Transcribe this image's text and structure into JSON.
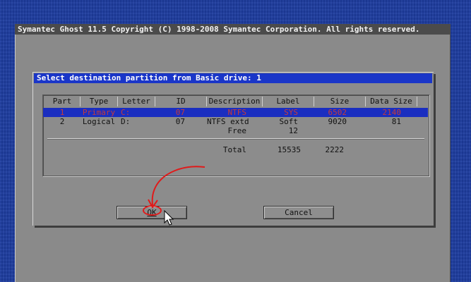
{
  "window": {
    "title": "Symantec Ghost 11.5   Copyright (C) 1998-2008 Symantec Corporation. All rights reserved."
  },
  "dialog": {
    "title": "Select destination partition from Basic drive: 1",
    "columns": [
      "Part",
      "Type",
      "Letter",
      "ID",
      "Description",
      "Label",
      "Size",
      "Data Size"
    ],
    "rows": [
      {
        "part": "1",
        "type": "Primary",
        "letter": "C:",
        "id": "07",
        "description": "NTFS",
        "label": "SYS",
        "size": "6502",
        "data_size": "2140"
      },
      {
        "part": "2",
        "type": "Logical",
        "letter": "D:",
        "id": "07",
        "description": "NTFS extd",
        "label": "Soft",
        "size": "9020",
        "data_size": "81"
      },
      {
        "part": "",
        "type": "",
        "letter": "",
        "id": "",
        "description": "Free",
        "label": "12",
        "size": "",
        "data_size": ""
      }
    ],
    "total": {
      "label": "Total",
      "value1": "15535",
      "value2": "2222"
    },
    "ok_label": "OK",
    "cancel_label": "Cancel"
  },
  "colors": {
    "desktop": "#1d3c9f",
    "window": "#8a8a8a",
    "dialog_title": "#1a36c8",
    "selection": "#1a2ec0",
    "annotation": "#e01a1a"
  }
}
